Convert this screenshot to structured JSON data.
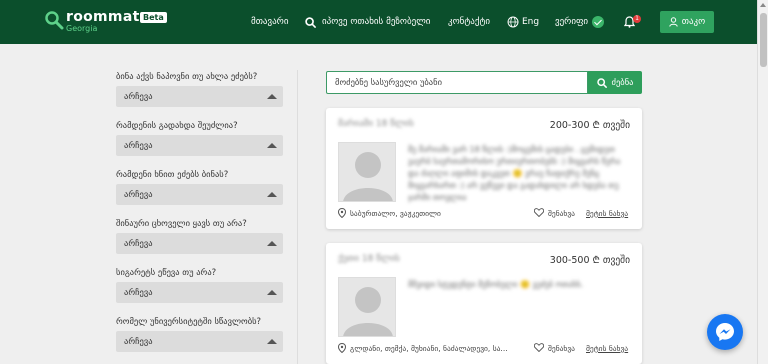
{
  "header": {
    "logo_text": "roommate",
    "logo_sub": "Georgia",
    "beta": "Beta",
    "nav": {
      "home": "მთავარი",
      "search_roommate": "იპოვე ოთახის მეზობელი",
      "contact": "კონტაქტი",
      "lang": "Eng",
      "verified": "ვერიფი",
      "notification_count": "1"
    },
    "user": "თაკო"
  },
  "filters": [
    {
      "label": "ბინა აქვს ნაპოვნი თუ ახლა ეძებს?",
      "value": "არჩევა"
    },
    {
      "label": "რამდენის გადახდა შეუძლია?",
      "value": "არჩევა"
    },
    {
      "label": "რამდენი ხნით ეძებს ბინას?",
      "value": "არჩევა"
    },
    {
      "label": "შინაური ცხოველი ყავს თუ არა?",
      "value": "არჩევა"
    },
    {
      "label": "სიგარეტს ეწევა თუ არა?",
      "value": "არჩევა"
    },
    {
      "label": "რომელ უნივერსიტეტში სწავლობს?",
      "value": "არჩევა"
    }
  ],
  "search": {
    "placeholder": "მოძებნე სასურველი უბანი",
    "button": "ძებნა"
  },
  "cards": [
    {
      "name": "მარიამი  18 წლის",
      "price": "200-300 ₾ თვეში",
      "description": "მე მარიამი ვარ 18 წლის :)მოცემის ცადები . ცემიდეთ ვაერბ საერთაშორისო ურთიერთობებს :) მიყვარს წერა და ძაღლი აფიშის დაკვეთ 🙂 ვრაე ჩაფიქრე შენც მიყვარხართ :) არ ვეწევი და გადახდილი არ ხდება თუ ჯარში თოვლია",
      "location": "საბურთალო, ვაჟკეთილი",
      "favorite": "შენახვა",
      "more": "მეტის ნახვა"
    },
    {
      "name": "ქეთი  18 წლის",
      "price": "300-500 ₾ თვეში",
      "description": "მშვიდი სტუდენტი მეზობელი 🙂 ვეძებ ოთახს.",
      "location": "გლდანი, თემქა, მუხიანი, ნაძალადევი, სა...",
      "favorite": "შენახვა",
      "more": "მეტის ნახვა"
    }
  ],
  "colors": {
    "header_bg": "#0b4f2c",
    "accent": "#2e9e5b",
    "messenger": "#1877f2"
  }
}
